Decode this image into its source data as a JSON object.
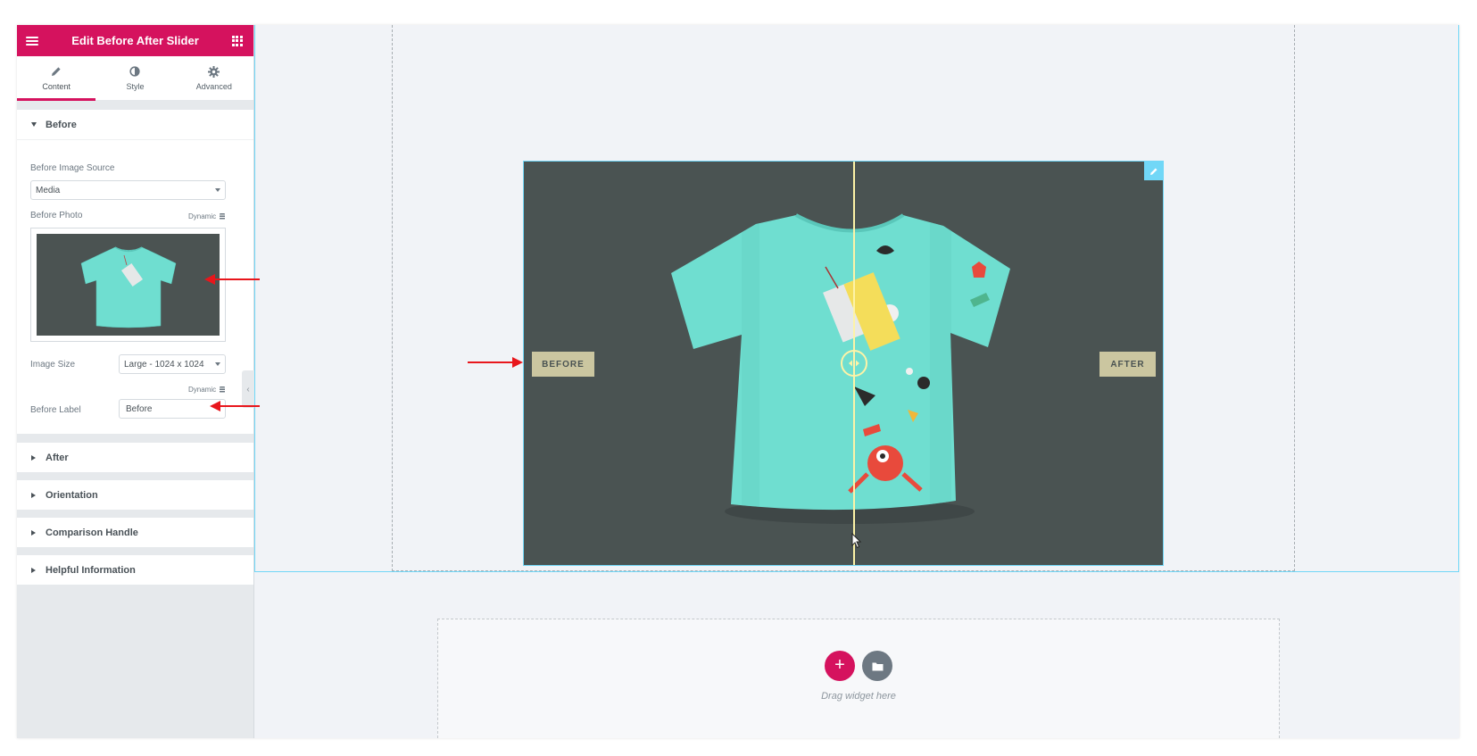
{
  "panel": {
    "title": "Edit Before After Slider",
    "tabs": [
      {
        "label": "Content",
        "icon": "pencil-icon"
      },
      {
        "label": "Style",
        "icon": "half-circle-icon"
      },
      {
        "label": "Advanced",
        "icon": "gear-icon"
      }
    ],
    "active_tab": "Content",
    "before_section": {
      "title": "Before",
      "image_source_label": "Before Image Source",
      "image_source_value": "Media",
      "photo_label": "Before Photo",
      "dynamic_label": "Dynamic",
      "image_size_label": "Image Size",
      "image_size_value": "Large - 1024 x 1024",
      "dynamic_label_2": "Dynamic",
      "before_label_label": "Before Label",
      "before_label_value": "Before"
    },
    "collapsed_sections": [
      "After",
      "Orientation",
      "Comparison Handle",
      "Helpful Information"
    ]
  },
  "canvas": {
    "before_badge": "BEFORE",
    "after_badge": "AFTER",
    "drop_text": "Drag widget here",
    "add_label": "+"
  },
  "colors": {
    "accent": "#d5125e",
    "selection": "#71d7f7",
    "slider_bg": "#4a5352",
    "tshirt": "#6fded0",
    "badge": "#cbc6a0",
    "divider": "#fdf3a7",
    "annotation_arrow": "#e8161c"
  }
}
